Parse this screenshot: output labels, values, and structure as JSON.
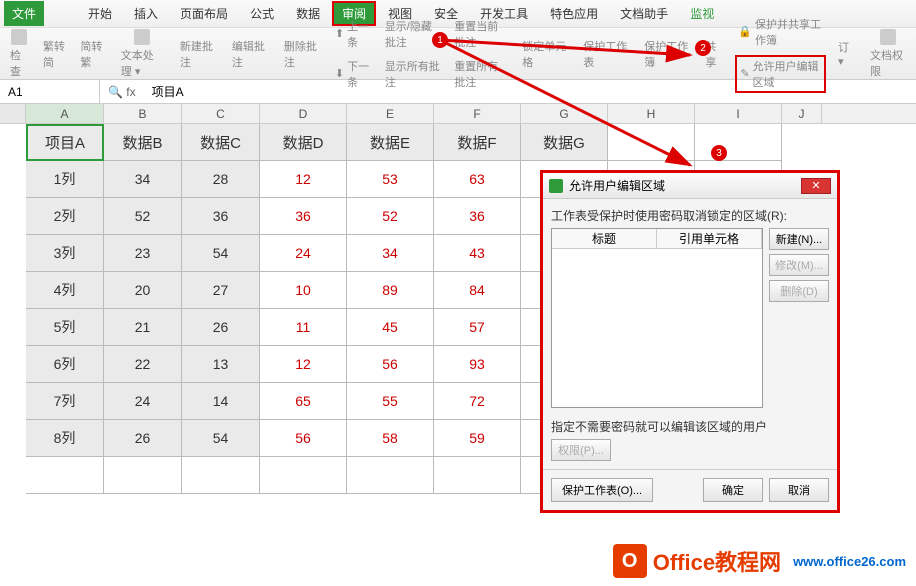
{
  "menu": {
    "file": "文件",
    "home": "开始",
    "insert": "插入",
    "layout": "页面布局",
    "formula": "公式",
    "data": "数据",
    "review": "审阅",
    "view": "视图",
    "safe": "安全",
    "dev": "开发工具",
    "special": "特色应用",
    "dochelp": "文档助手",
    "monitor": "监视"
  },
  "toolbar": {
    "check": "检查",
    "zhh": "繁转简",
    "jzh": "简转繁",
    "txt": "文本处理 ▾",
    "newcm": "新建批注",
    "editcm": "编辑批注",
    "delcm": "删除批注",
    "prev": "上一条",
    "next": "下一条",
    "showhide": "显示/隐藏批注",
    "showall": "显示所有批注",
    "reset": "重置当前批注",
    "resetall": "重置所有批注",
    "lock": "锁定单元格",
    "protect": "保护工作表",
    "protectbook": "保护工作簿",
    "share": "共享",
    "allowedit": "允许用户编辑区域",
    "protshare": "保护并共享工作簿",
    "trackchanges": "订 ▾",
    "docperm": "文档权限"
  },
  "nameBox": "A1",
  "fxVal": "项目A",
  "cols": [
    "A",
    "B",
    "C",
    "D",
    "E",
    "F",
    "G",
    "H",
    "I",
    "J"
  ],
  "headers": [
    "项目A",
    "数据B",
    "数据C",
    "数据D",
    "数据E",
    "数据F",
    "数据G"
  ],
  "rows": [
    {
      "lbl": "1列",
      "b": "34",
      "c": "28",
      "d": "12",
      "e": "53",
      "f": "63"
    },
    {
      "lbl": "2列",
      "b": "52",
      "c": "36",
      "d": "36",
      "e": "52",
      "f": "36"
    },
    {
      "lbl": "3列",
      "b": "23",
      "c": "54",
      "d": "24",
      "e": "34",
      "f": "43"
    },
    {
      "lbl": "4列",
      "b": "20",
      "c": "27",
      "d": "10",
      "e": "89",
      "f": "84"
    },
    {
      "lbl": "5列",
      "b": "21",
      "c": "26",
      "d": "11",
      "e": "45",
      "f": "57"
    },
    {
      "lbl": "6列",
      "b": "22",
      "c": "13",
      "d": "12",
      "e": "56",
      "f": "93"
    },
    {
      "lbl": "7列",
      "b": "24",
      "c": "14",
      "d": "65",
      "e": "55",
      "f": "72"
    },
    {
      "lbl": "8列",
      "b": "26",
      "c": "54",
      "d": "56",
      "e": "58",
      "f": "59"
    }
  ],
  "dialog": {
    "title": "允许用户编辑区域",
    "label": "工作表受保护时使用密码取消锁定的区域(R):",
    "col1": "标题",
    "col2": "引用单元格",
    "new": "新建(N)...",
    "modify": "修改(M)...",
    "delete": "删除(D)",
    "note": "指定不需要密码就可以编辑该区域的用户",
    "perm": "权限(P)...",
    "protect": "保护工作表(O)...",
    "ok": "确定",
    "cancel": "取消"
  },
  "badges": {
    "b1": "1",
    "b2": "2",
    "b3": "3"
  },
  "watermark": {
    "brand": "Office教程网",
    "url": "www.office26.com"
  }
}
